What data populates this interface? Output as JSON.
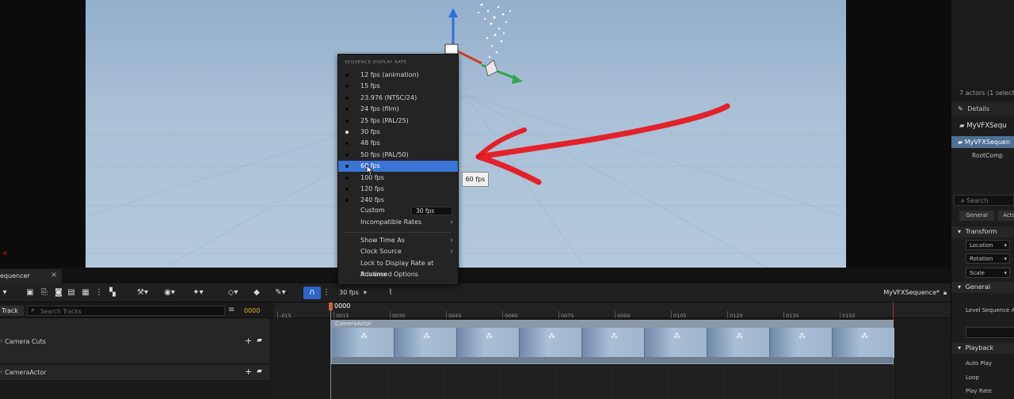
{
  "viewport": {
    "axis_label": "-X"
  },
  "menu": {
    "header": "SEQUENCE DISPLAY RATE",
    "rates": [
      {
        "label": "12 fps (animation)",
        "checked": false
      },
      {
        "label": "15 fps",
        "checked": false
      },
      {
        "label": "23.976 (NTSC/24)",
        "checked": false
      },
      {
        "label": "24 fps (film)",
        "checked": false
      },
      {
        "label": "25 fps (PAL/25)",
        "checked": false
      },
      {
        "label": "30 fps",
        "checked": true
      },
      {
        "label": "48 fps",
        "checked": false
      },
      {
        "label": "50 fps (PAL/50)",
        "checked": false
      },
      {
        "label": "60 fps",
        "checked": false,
        "highlighted": true
      },
      {
        "label": "100 fps",
        "checked": false
      },
      {
        "label": "120 fps",
        "checked": false
      },
      {
        "label": "240 fps",
        "checked": false
      }
    ],
    "custom_label": "Custom",
    "custom_value": "30 fps",
    "incompatible": "Incompatible Rates",
    "show_time_as": "Show Time As",
    "clock_source": "Clock Source",
    "lock_display_rate": "Lock to Display Rate at Runtime",
    "advanced_options": "Advanced Options"
  },
  "tooltip": "60 fps",
  "right_panel": {
    "actors_count": "7 actors (1 selecte",
    "details_tab": "Details",
    "object_name": "MyVFXSequ",
    "tree_selected": "MyVFXSequen",
    "tree_child": "RootComp",
    "search_placeholder": "Search",
    "filter_general": "General",
    "filter_actor": "Acto",
    "section_transform": "Transform",
    "location": "Location",
    "rotation": "Rotation",
    "scale": "Scale",
    "section_general": "General",
    "level_sequence": "Level Sequence As",
    "section_playback": "Playback",
    "auto_play": "Auto Play",
    "loop": "Loop",
    "play_rate": "Play Rate"
  },
  "sequencer": {
    "tab_label": "equencer",
    "tab_close": "×",
    "fps_label": "30 fps",
    "sequence_name": "MyVFXSequence*",
    "track_button": "Track",
    "search_placeholder": "Search Tracks",
    "current_frame": "0000",
    "playhead_frame": "0000",
    "tracks": [
      {
        "name": "Camera Cuts"
      },
      {
        "name": "CameraActor"
      }
    ],
    "clip_label": "CameraActor",
    "ruler_ticks": [
      "-015",
      "0015",
      "0030",
      "0045",
      "0060",
      "0075",
      "0090",
      "0105",
      "0120",
      "0135",
      "0150"
    ]
  },
  "colors": {
    "accent": "#3a74d4",
    "playhead": "#d0613a",
    "annotation_arrow": "#e8141b",
    "frame_orange": "#e8a33a"
  }
}
